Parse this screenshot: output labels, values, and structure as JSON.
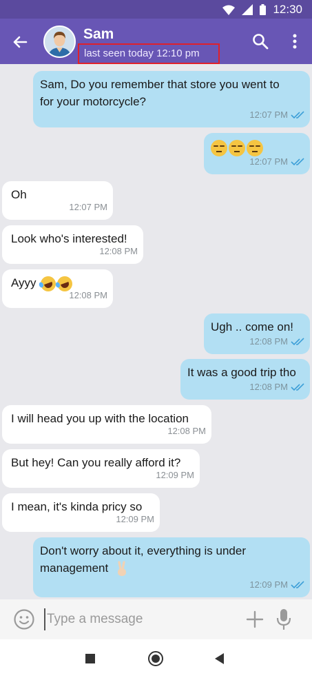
{
  "status_bar": {
    "time": "12:30"
  },
  "header": {
    "contact_name": "Sam",
    "last_seen": "last seen today 12:10 pm"
  },
  "messages": [
    {
      "direction": "out",
      "lines": [
        "Sam, Do you remember that store you went to",
        "for your motorcycle?"
      ],
      "time": "12:07 PM",
      "read": true
    },
    {
      "direction": "out",
      "emoji": [
        "unamused-face",
        "unamused-face",
        "unamused-face"
      ],
      "time": "12:07 PM",
      "read": true
    },
    {
      "direction": "in",
      "text": "Oh",
      "time": "12:07 PM"
    },
    {
      "direction": "in",
      "text": "Look who's interested!",
      "time": "12:08 PM"
    },
    {
      "direction": "in",
      "text": "Ayyy",
      "emoji": [
        "rolling-laughing-face",
        "rolling-laughing-face"
      ],
      "time": "12:08 PM"
    },
    {
      "direction": "out",
      "text": "Ugh .. come on!",
      "time": "12:08 PM",
      "read": true
    },
    {
      "direction": "out",
      "text": "It was a good trip tho",
      "time": "12:08 PM",
      "read": true
    },
    {
      "direction": "in",
      "text": "I will head you up with the location",
      "time": "12:08 PM"
    },
    {
      "direction": "in",
      "text": "But hey! Can you really afford it?",
      "time": "12:09 PM"
    },
    {
      "direction": "in",
      "text": "I mean, it's kinda pricy so",
      "time": "12:09 PM"
    },
    {
      "direction": "out",
      "lines": [
        "Don't worry about it, everything is under",
        "management"
      ],
      "emoji": [
        "victory-hand"
      ],
      "time": "12:09 PM",
      "read": true
    }
  ],
  "composer": {
    "placeholder": "Type a message"
  },
  "colors": {
    "app_bar": "#6856b5",
    "status_bar": "#5b4a9e",
    "outgoing_bubble": "#b2dff3",
    "incoming_bubble": "#ffffff",
    "read_check": "#3d9fd8",
    "highlight_box": "#e0202a"
  }
}
